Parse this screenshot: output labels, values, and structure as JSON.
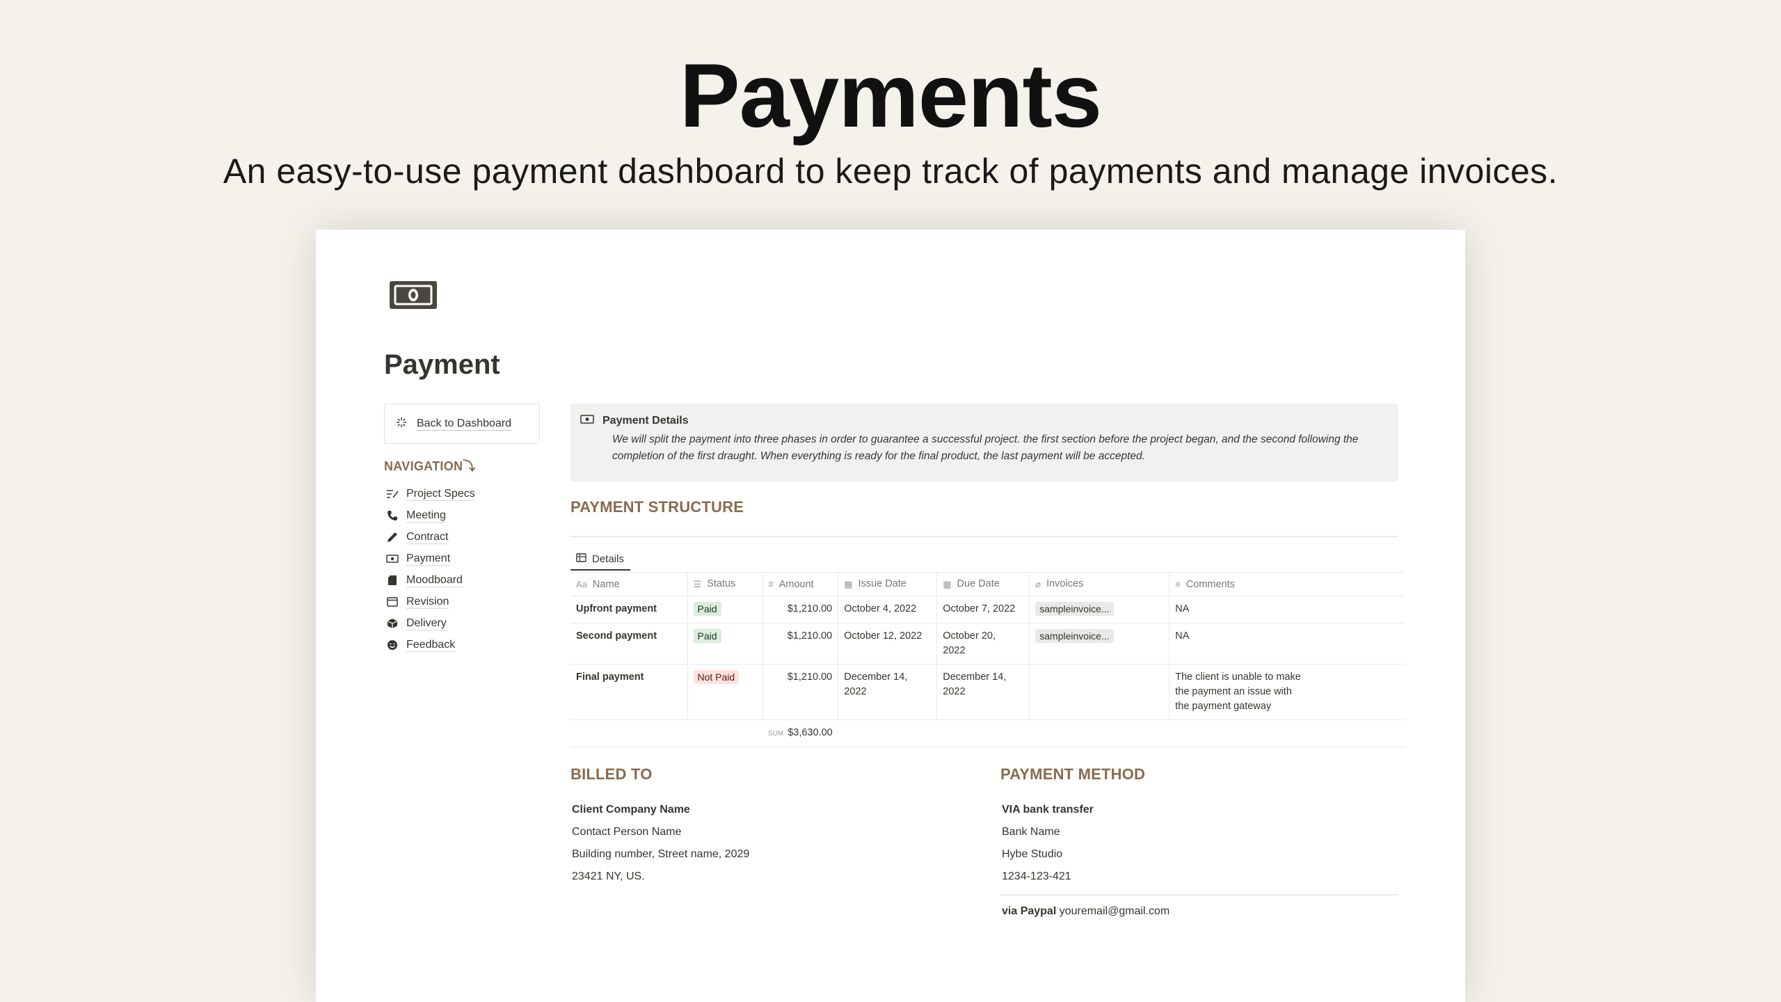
{
  "hero": {
    "title": "Payments",
    "subtitle": "An easy-to-use payment dashboard to keep track of payments and manage invoices."
  },
  "page": {
    "icon": "banknote-icon",
    "title": "Payment"
  },
  "sidebar": {
    "back_label": "Back to Dashboard",
    "nav_heading": "NAVIGATION⤵",
    "items": [
      {
        "label": "Project Specs",
        "icon": "edit-list-icon"
      },
      {
        "label": "Meeting",
        "icon": "phone-icon"
      },
      {
        "label": "Contract",
        "icon": "pencil-icon"
      },
      {
        "label": "Payment",
        "icon": "banknote-icon"
      },
      {
        "label": "Moodboard",
        "icon": "clipboard-icon"
      },
      {
        "label": "Revision",
        "icon": "window-icon"
      },
      {
        "label": "Delivery",
        "icon": "package-icon"
      },
      {
        "label": "Feedback",
        "icon": "smiley-icon"
      }
    ]
  },
  "callout": {
    "title": "Payment Details",
    "body": "We will split the payment into three phases in order to guarantee a successful project. the first section before the project began, and the second following the completion of the first draught. When everything is ready for the final product, the last payment will be accepted."
  },
  "payment_structure": {
    "heading": "PAYMENT STRUCTURE",
    "view_tab": "Details",
    "columns": [
      {
        "label": "Name",
        "icon": "Aa"
      },
      {
        "label": "Status",
        "icon": "list-icon"
      },
      {
        "label": "Amount",
        "icon": "#"
      },
      {
        "label": "Issue Date",
        "icon": "calendar-icon"
      },
      {
        "label": "Due Date",
        "icon": "calendar-icon"
      },
      {
        "label": "Invoices",
        "icon": "paperclip-icon"
      },
      {
        "label": "Comments",
        "icon": "text-icon"
      }
    ],
    "rows": [
      {
        "name": "Upfront payment",
        "status": "Paid",
        "amount": "$1,210.00",
        "issue": "October 4, 2022",
        "due": "October 7, 2022",
        "invoice": "sampleinvoice...",
        "comments": "NA"
      },
      {
        "name": "Second payment",
        "status": "Paid",
        "amount": "$1,210.00",
        "issue": "October 12, 2022",
        "due": "October 20, 2022",
        "invoice": "sampleinvoice...",
        "comments": "NA"
      },
      {
        "name": "Final payment",
        "status": "Not Paid",
        "amount": "$1,210.00",
        "issue": "December 14, 2022",
        "due": "December 14, 2022",
        "invoice": "",
        "comments": "The client is unable to make the payment an issue with the payment gateway"
      }
    ],
    "sum_label": "SUM",
    "sum_value": "$3,630.00"
  },
  "billed_to": {
    "heading": "BILLED TO",
    "company": "Client Company Name",
    "contact": "Contact Person Name",
    "address": "Building number, Street name, 2029",
    "city": "23421 NY, US."
  },
  "payment_method": {
    "heading": "PAYMENT METHOD",
    "bank_title": "VIA bank transfer",
    "bank_name": "Bank Name",
    "account_name": "Hybe Studio",
    "account_number": "1234-123-421",
    "paypal_label": "via Paypal",
    "paypal_email": "youremail@gmail.com"
  },
  "colors": {
    "background": "#f5f2eb",
    "accent_brown": "#8a6a4e",
    "paid_bg": "#dbeddb",
    "not_paid_bg": "#ffe2dd"
  }
}
